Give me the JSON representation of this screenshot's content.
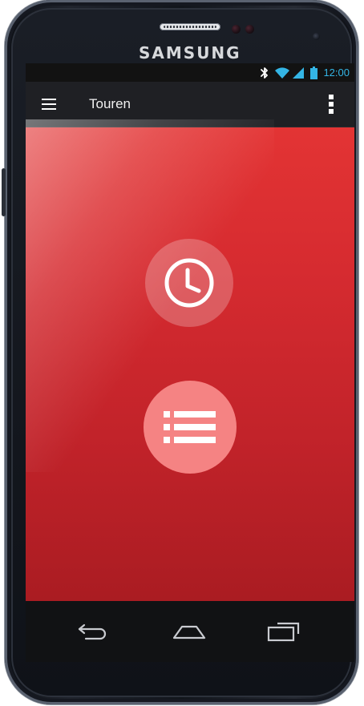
{
  "device": {
    "brand": "SAMSUNG"
  },
  "status_bar": {
    "time": "12:00",
    "icons": [
      "bluetooth-icon",
      "wifi-icon",
      "signal-icon",
      "battery-icon"
    ],
    "accent_color": "#34b5e5"
  },
  "action_bar": {
    "title": "Touren",
    "menu_icon": "hamburger-menu-icon",
    "overflow_icon": "overflow-menu-icon"
  },
  "main": {
    "background_color": "#d62b30",
    "buttons": [
      {
        "icon": "clock-icon"
      },
      {
        "icon": "list-icon",
        "color": "#f58383"
      }
    ]
  },
  "navigation_bar": {
    "buttons": [
      "back-icon",
      "home-icon",
      "recent-apps-icon"
    ]
  }
}
